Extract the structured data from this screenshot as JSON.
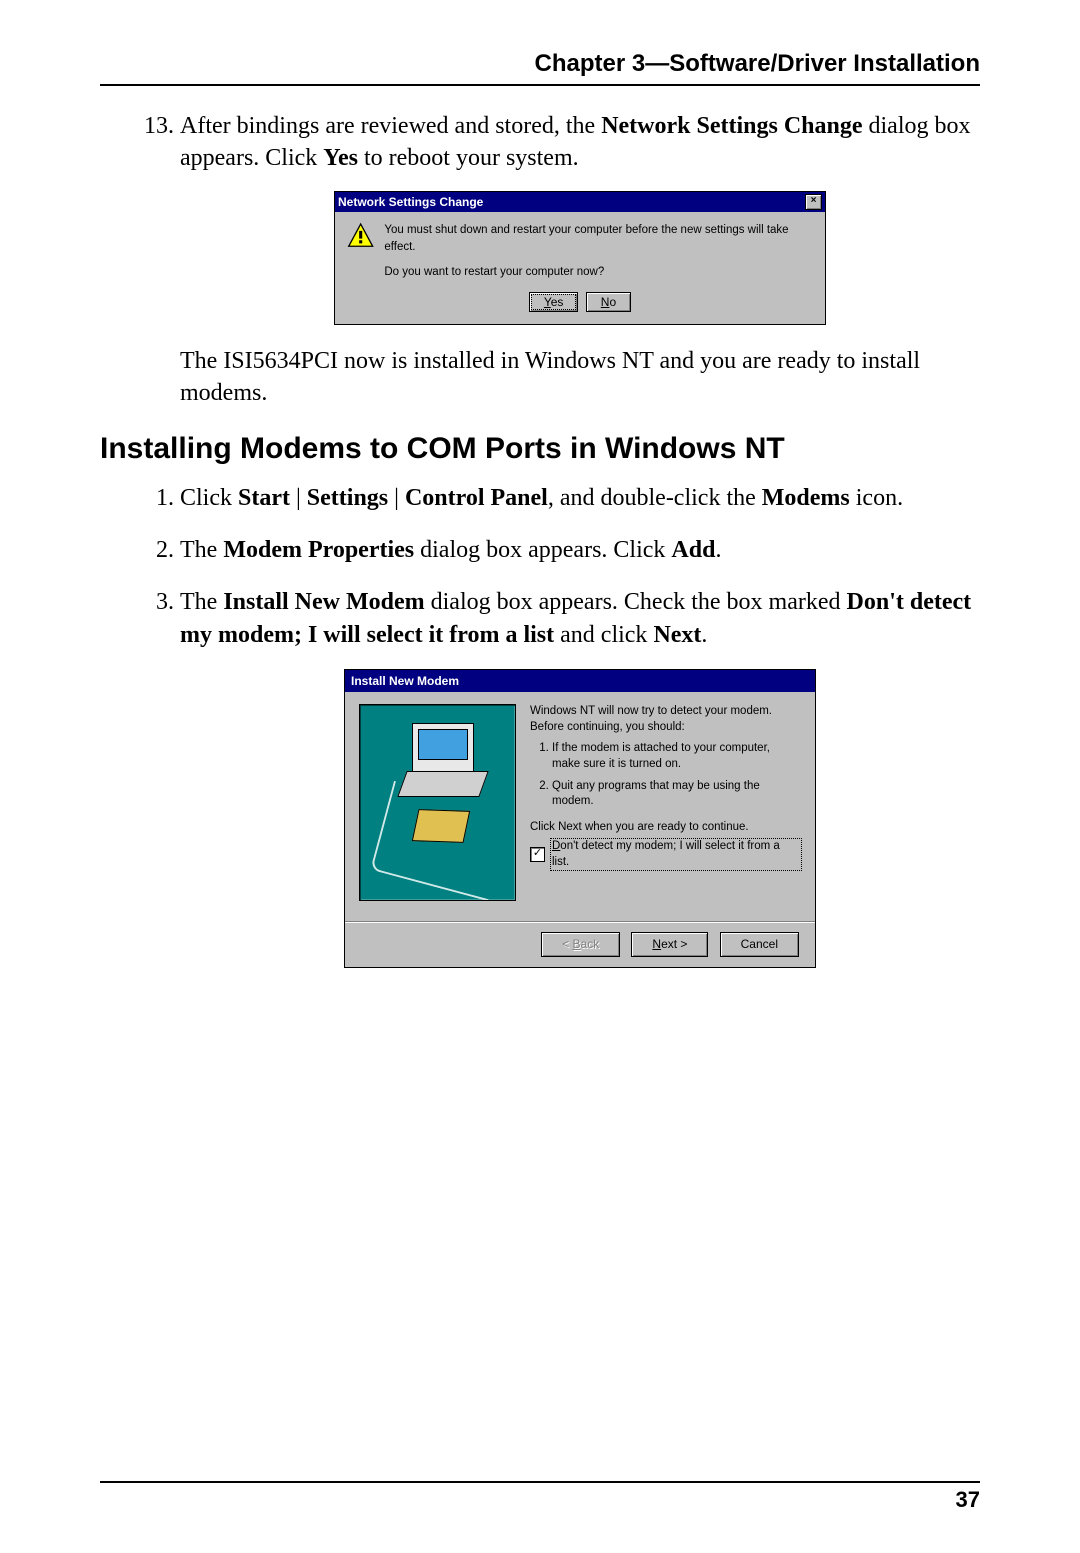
{
  "header": {
    "chapter": "Chapter 3—Software/Driver Installation"
  },
  "page_number": "37",
  "item13": {
    "number": "13.",
    "p1a": "After bindings are reviewed and stored, the ",
    "p1b_bold": "Network Settings Change",
    "p1c": " dialog box appears. Click ",
    "p1d_bold": "Yes",
    "p1e": " to reboot your system."
  },
  "nsc_dialog": {
    "title": "Network Settings Change",
    "line1": "You must shut down and restart your computer before the new settings will take effect.",
    "line2": "Do you want to restart your computer now?",
    "yes_u": "Y",
    "yes_rest": "es",
    "no_u": "N",
    "no_rest": "o"
  },
  "after13": "The ISI5634PCI now is installed in Windows NT and you are ready to install modems.",
  "heading": "Installing Modems to COM Ports in Windows NT",
  "steps": {
    "s1": {
      "a": "Click ",
      "b": "Start",
      "c": " | ",
      "d": "Settings",
      "e": " | ",
      "f": "Control Panel",
      "g": ", and double-click the ",
      "h": "Modems",
      "i": " icon."
    },
    "s2": {
      "a": "The ",
      "b": "Modem Properties",
      "c": " dialog box appears.  Click ",
      "d": "Add",
      "e": "."
    },
    "s3": {
      "a": "The ",
      "b": "Install New Modem",
      "c": " dialog box appears.  Check the box marked ",
      "d": "Don't detect my modem; I will select it from a list",
      "e": " and click ",
      "f": "Next",
      "g": "."
    }
  },
  "inm_dialog": {
    "title": "Install New Modem",
    "intro": "Windows NT will now try to detect your modem.  Before continuing, you should:",
    "li1": "If the modem is attached to your computer, make sure it is turned on.",
    "li2": "Quit any programs that may be using the modem.",
    "cont": "Click Next when you are ready to continue.",
    "check_u": "D",
    "check_rest": "on't detect my modem; I will select it from a list.",
    "back_lt": "< ",
    "back_u": "B",
    "back_rest": "ack",
    "next_u": "N",
    "next_rest": "ext >",
    "cancel": "Cancel"
  }
}
